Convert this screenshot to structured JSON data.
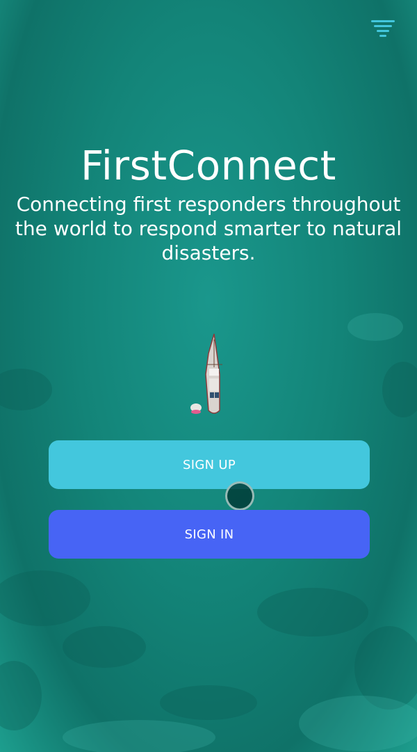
{
  "header": {
    "menu_icon": "filter-menu-icon",
    "accent_color": "#43c7dd"
  },
  "hero": {
    "title": "FirstConnect",
    "tagline": "Connecting first responders throughout the world to respond smarter to natural disasters."
  },
  "actions": {
    "sign_up_label": "SIGN UP",
    "sign_in_label": "SIGN IN"
  },
  "colors": {
    "sign_up": "#43c7dd",
    "sign_in": "#4764f5",
    "background": "#138478"
  },
  "background": {
    "image": "aerial-sea-boat"
  }
}
